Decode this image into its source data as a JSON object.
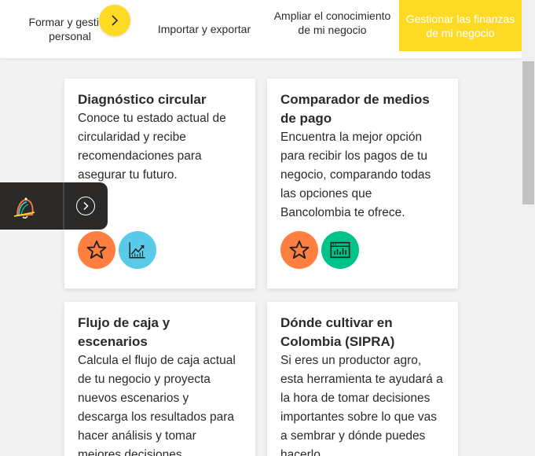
{
  "tabs": [
    {
      "label": "Formar y gestionar lo personal"
    },
    {
      "label": "Importar y exportar"
    },
    {
      "label": "Ampliar el conocimiento de mi negocio"
    },
    {
      "label": "Gestionar las finanzas de mi negocio"
    }
  ],
  "tab_display": {
    "first": "Formar y gestion personal"
  },
  "cards": [
    {
      "title": "Diagnóstico circular",
      "description": "Conoce tu estado actual de circularidad y recibe recomendaciones para asegurar tu futuro.",
      "icons": [
        "star-icon",
        "chart-up-icon"
      ]
    },
    {
      "title": "Comparador de medios de pago",
      "description": "Encuentra la mejor opción para recibir los pagos de tu negocio, comparando todas las opciones que Bancolombia te ofrece.",
      "icons": [
        "star-icon",
        "dashboard-icon"
      ]
    },
    {
      "title": "Flujo de caja y escenarios",
      "description": "Calcula el flujo de caja actual de tu negocio y proyecta nuevos escenarios y descarga los resultados para hacer análisis y tomar mejores decisiones."
    },
    {
      "title": "Dónde cultivar en Colombia (SIPRA)",
      "description": "Si eres un productor agro, esta herramienta te ayudará a la hora de tomar decisiones importantes sobre lo que vas a sembrar y dónde puedes hacerlo."
    }
  ],
  "colors": {
    "accent_yellow": "#fdda24",
    "orange": "#ff7f41",
    "blue": "#59cbe8",
    "green": "#00c389",
    "dark": "#2c2a29"
  }
}
